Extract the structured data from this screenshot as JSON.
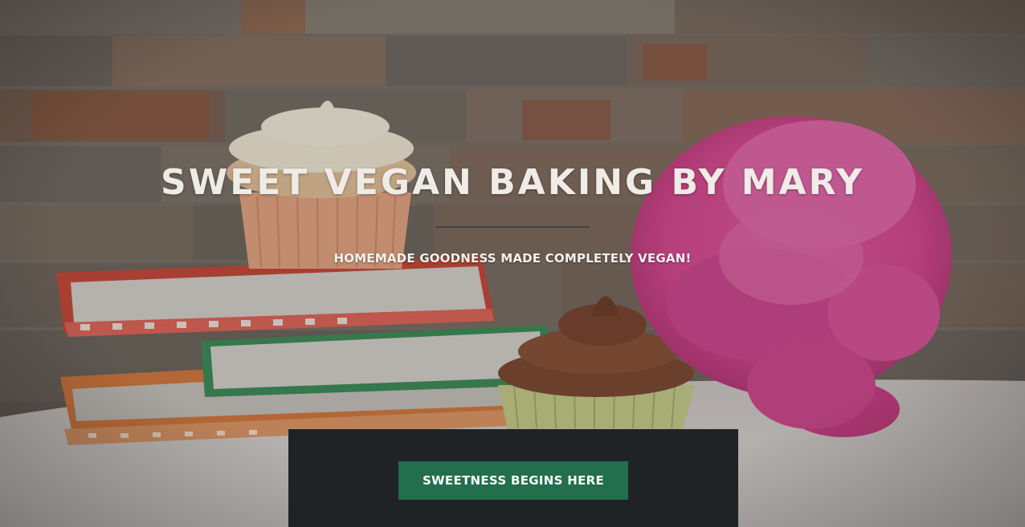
{
  "hero": {
    "title": "SWEET VEGAN BAKING BY MARY",
    "subtitle": "HOMEMADE GOODNESS MADE COMPLETELY VEGAN!",
    "cta_label": "SWEETNESS BEGINS HERE"
  },
  "colors": {
    "title_text": "#efebe7",
    "cta_background": "#236e4d",
    "cta_panel": "#202325"
  }
}
